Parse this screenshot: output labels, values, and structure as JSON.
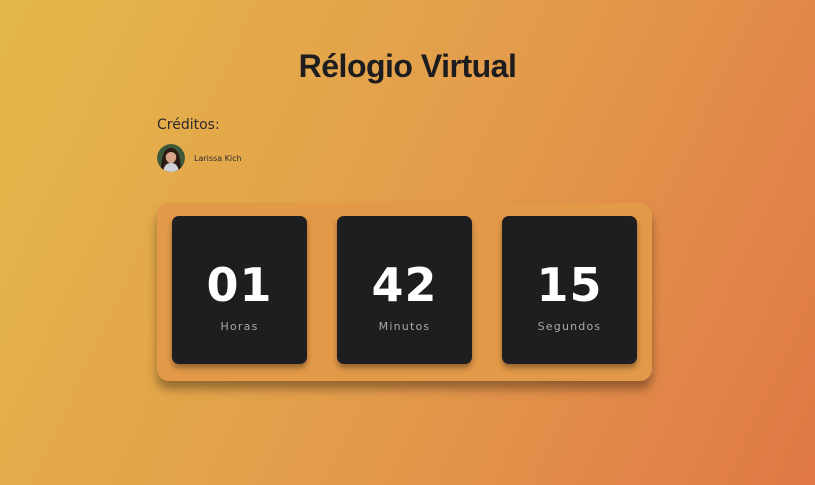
{
  "page": {
    "title": "Rélogio Virtual"
  },
  "credits": {
    "label": "Créditos:",
    "author": {
      "name": "Larissa Kich",
      "avatar_icon": "avatar-photo"
    }
  },
  "clock": {
    "units": [
      {
        "value": "01",
        "label": "Horas"
      },
      {
        "value": "42",
        "label": "Minutos"
      },
      {
        "value": "15",
        "label": "Segundos"
      }
    ]
  },
  "colors": {
    "background_start": "#e4b84a",
    "background_end": "#e07846",
    "panel": "#e39a48",
    "card": "#1e1d1f",
    "text_dark": "#1d1c1f",
    "digit": "#ffffff",
    "unit_label": "#a9a8a8"
  }
}
